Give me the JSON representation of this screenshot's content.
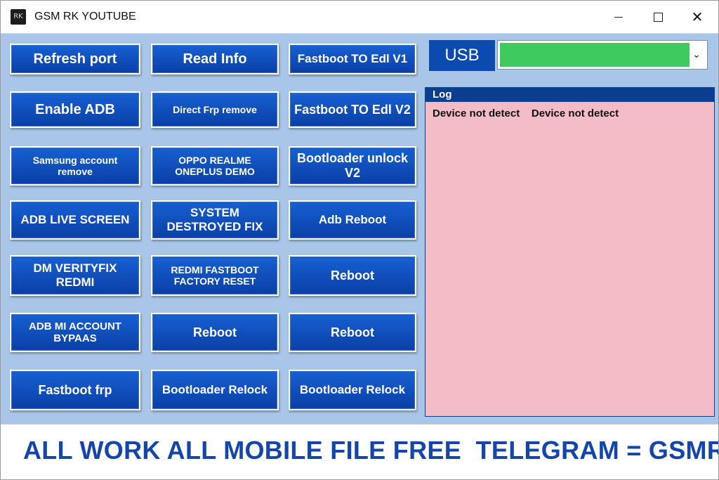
{
  "window": {
    "title": "GSM RK YOUTUBE",
    "icon_text": "RK",
    "controls": {
      "minimize": "minimize-icon",
      "maximize": "maximize-icon",
      "close": "close-icon"
    }
  },
  "buttons": {
    "col1": [
      "Refresh port",
      "Enable ADB",
      "Samsung account remove",
      "ADB LIVE SCREEN",
      "DM VERITYFIX REDMI",
      "ADB MI ACCOUNT BYPAAS",
      "Fastboot frp"
    ],
    "col2": [
      "Read Info",
      "Direct Frp remove",
      "OPPO REALME ONEPLUS DEMO",
      "SYSTEM DESTROYED FIX",
      "REDMI FASTBOOT FACTORY RESET",
      "Reboot",
      "Bootloader Relock"
    ],
    "col3": [
      "Fastboot TO Edl V1",
      "Fastboot TO Edl V2",
      "Bootloader unlock V2",
      "Adb Reboot",
      "Reboot",
      "Reboot",
      "Bootloader Relock"
    ]
  },
  "usb": {
    "label": "USB",
    "selected_value": "",
    "status_color": "#3fca60",
    "dropdown_icon": "chevron-down-icon"
  },
  "log": {
    "header": "Log",
    "text": "Device not detect    Device not detect"
  },
  "banner": {
    "text": "ALL WORK ALL MOBILE FILE FREE  TELEGRAM = GSMRK"
  },
  "colors": {
    "button_blue": "#0b4aae",
    "client_background": "#a9c6e8",
    "log_background": "#f4bcc6",
    "banner_text": "#1346a8"
  }
}
